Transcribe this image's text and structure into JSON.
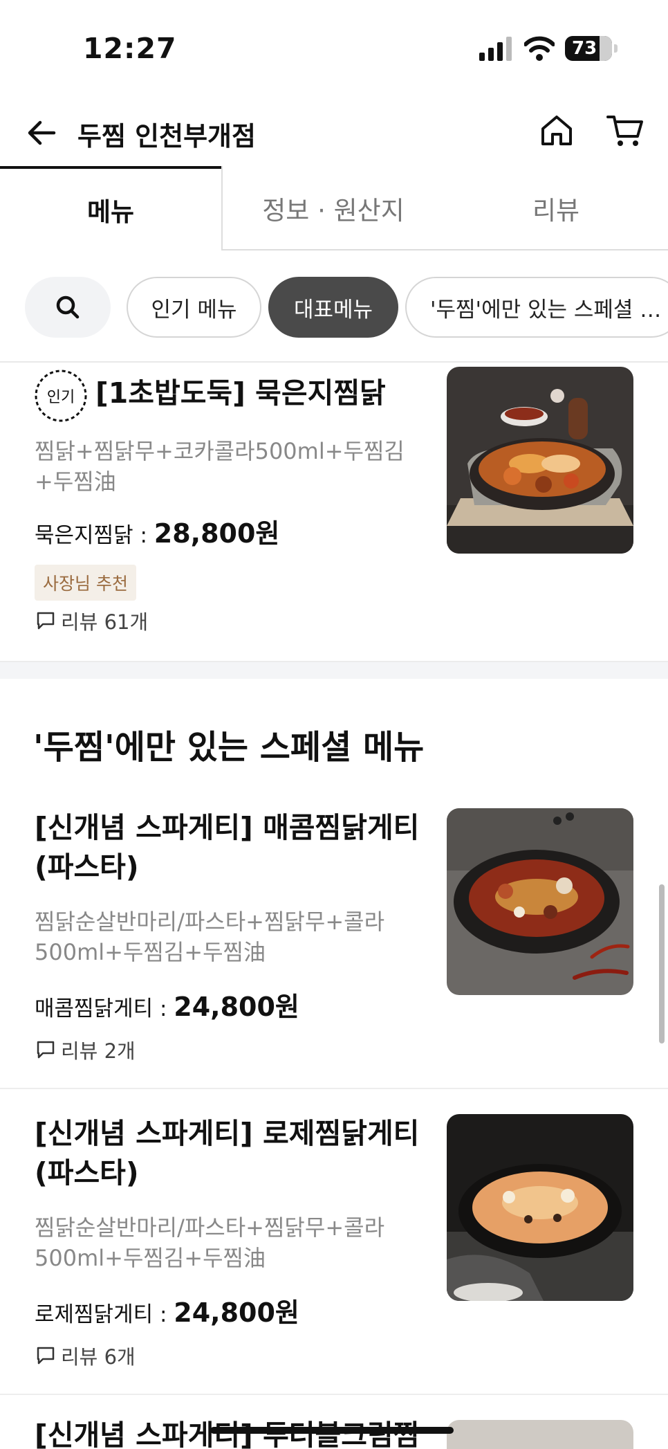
{
  "status_bar": {
    "time": "12:27",
    "battery": "73"
  },
  "header": {
    "store_name": "두찜 인천부개점"
  },
  "tabs": [
    {
      "label": "메뉴",
      "active": true
    },
    {
      "label": "정보 · 원산지",
      "active": false
    },
    {
      "label": "리뷰",
      "active": false
    }
  ],
  "chips": [
    {
      "label": "인기 메뉴",
      "active": false
    },
    {
      "label": "대표메뉴",
      "active": true
    },
    {
      "label": "'두찜'에만 있는 스페셜 …",
      "active": false
    }
  ],
  "featured_item": {
    "badge": "인기",
    "name": "[1초밥도둑] 묵은지찜닭",
    "desc": "찜닭+찜닭무+코카콜라500ml+두찜김+두찜油",
    "price_label": "묵은지찜닭 : ",
    "price": "28,800원",
    "tag": "사장님 추천",
    "reviews": "리뷰 61개"
  },
  "section": {
    "title": "'두찜'에만 있는 스페셜 메뉴"
  },
  "items": [
    {
      "name": "[신개념 스파게티] 매콤찜닭게티(파스타)",
      "desc": "찜닭순살반마리/파스타+찜닭무+콜라500ml+두찜김+두찜油",
      "price_label": "매콤찜닭게티 : ",
      "price": "24,800원",
      "reviews": "리뷰 2개"
    },
    {
      "name": "[신개념 스파게티] 로제찜닭게티(파스타)",
      "desc": "찜닭순살반마리/파스타+찜닭무+콜라500ml+두찜김+두찜油",
      "price_label": "로제찜닭게티 : ",
      "price": "24,800원",
      "reviews": "리뷰 6개"
    },
    {
      "name": "[신개념 스파게티] 투더블크림찜"
    }
  ],
  "colors": {
    "accent_dark": "#4a4a4a",
    "owner_badge_bg": "#f4efe8",
    "owner_badge_text": "#9a6b3f"
  }
}
